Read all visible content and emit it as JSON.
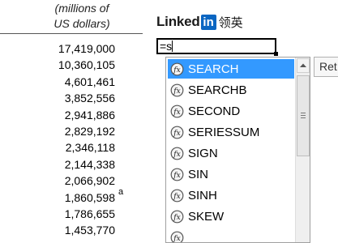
{
  "header": {
    "line1": "(millions of",
    "line2": "US dollars)"
  },
  "values": [
    "17,419,000",
    "10,360,105",
    "4,601,461",
    "3,852,556",
    "2,941,886",
    "2,829,192",
    "2,346,118",
    "2,144,338",
    "2,066,902",
    "1,860,598",
    "1,786,655",
    "1,453,770"
  ],
  "note_marker": "a",
  "logo": {
    "word": "Linked",
    "box": "in",
    "cn": "领英"
  },
  "cell": {
    "value": "=s"
  },
  "autocomplete": {
    "items": [
      "SEARCH",
      "SEARCHB",
      "SECOND",
      "SERIESSUM",
      "SIGN",
      "SIN",
      "SINH",
      "SKEW"
    ],
    "selected": 0,
    "icon": "function-icon",
    "selected_color": "#3399ff"
  },
  "tooltip": {
    "text": "Ret"
  },
  "colors": {
    "linkedin_blue": "#0a66c2"
  }
}
